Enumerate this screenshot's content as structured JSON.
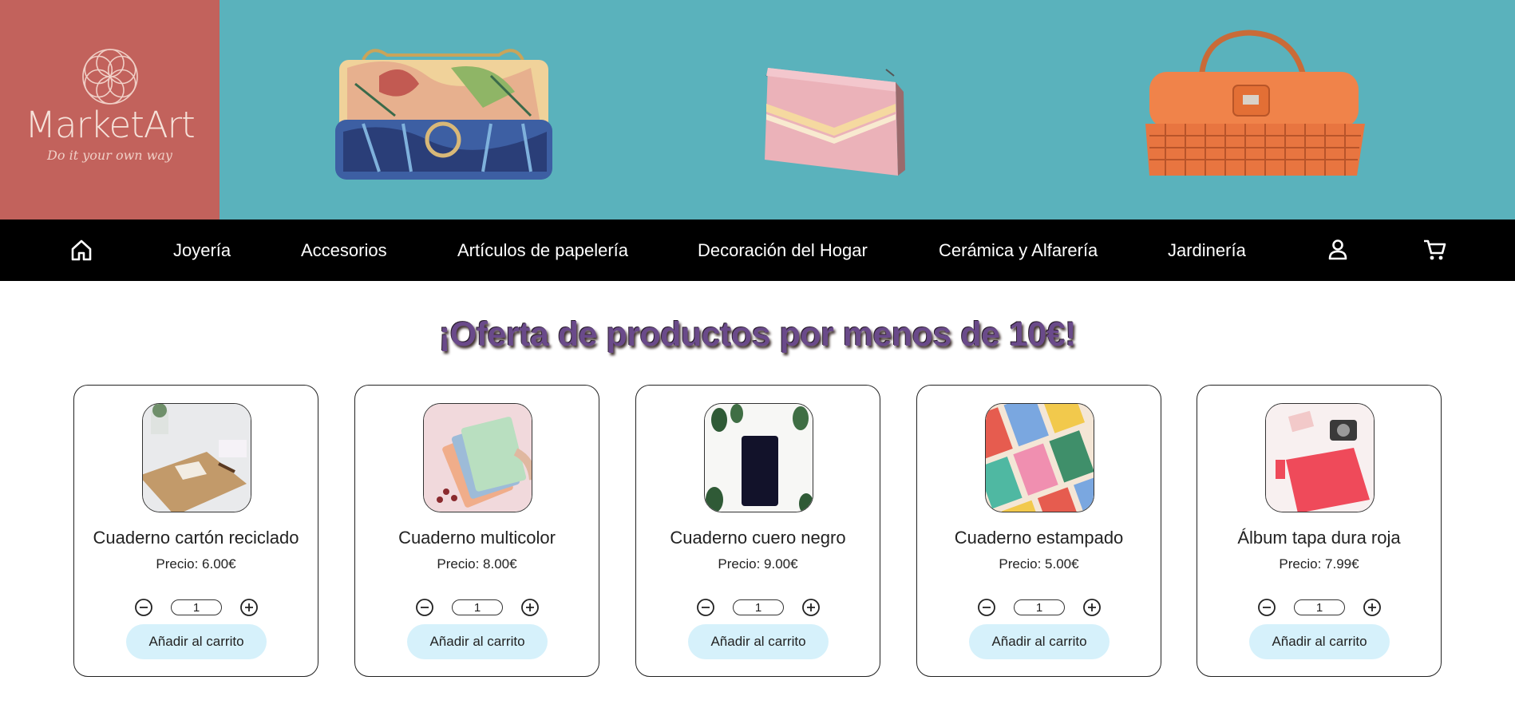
{
  "brand": {
    "name": "MarketArt",
    "tagline": "Do it your own way",
    "logo_color": "#c2625c",
    "banner_color": "#5ab2bc"
  },
  "nav": {
    "home_icon": "home-icon",
    "items": [
      {
        "label": "Joyería"
      },
      {
        "label": "Accesorios"
      },
      {
        "label": "Artículos de papelería"
      },
      {
        "label": "Decoración del Hogar"
      },
      {
        "label": "Cerámica y Alfarería"
      },
      {
        "label": "Jardinería"
      }
    ],
    "user_icon": "user-icon",
    "cart_icon": "cart-icon"
  },
  "offer": {
    "title": "¡Oferta de productos por menos de 10€!"
  },
  "products": [
    {
      "name": "Cuaderno cartón reciclado",
      "price": "Precio: 6.00€",
      "qty": "1",
      "add_label": "Añadir al carrito"
    },
    {
      "name": "Cuaderno multicolor",
      "price": "Precio: 8.00€",
      "qty": "1",
      "add_label": "Añadir al carrito"
    },
    {
      "name": "Cuaderno cuero negro",
      "price": "Precio: 9.00€",
      "qty": "1",
      "add_label": "Añadir al carrito"
    },
    {
      "name": "Cuaderno estampado",
      "price": "Precio: 5.00€",
      "qty": "1",
      "add_label": "Añadir al carrito"
    },
    {
      "name": "Álbum tapa dura roja",
      "price": "Precio: 7.99€",
      "qty": "1",
      "add_label": "Añadir al carrito"
    }
  ],
  "colors": {
    "nav_bg": "#000000",
    "add_button_bg": "#d6f1fb"
  }
}
